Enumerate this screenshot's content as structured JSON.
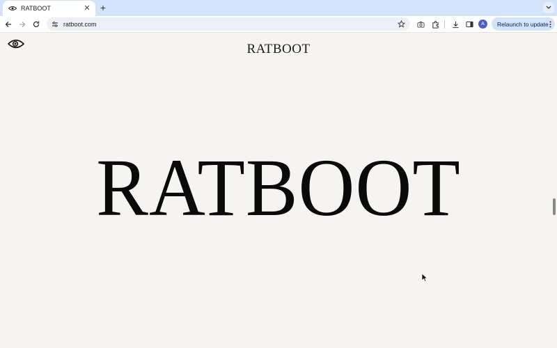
{
  "browser": {
    "tab": {
      "title": "RATBOOT",
      "favicon": "eye-icon"
    },
    "new_tab_icon": "plus-icon",
    "address_bar": {
      "url": "ratboot.com"
    },
    "relaunch_label": "Relaunch to update",
    "profile_initial": "A"
  },
  "page": {
    "header_brand": "RATBOOT",
    "hero_brand": "RATBOOT",
    "logo_icon": "eye-icon"
  },
  "colors": {
    "page_background": "#f6f4f0",
    "tabstrip": "#d3e3fd",
    "avatar": "#4e5fc2"
  }
}
